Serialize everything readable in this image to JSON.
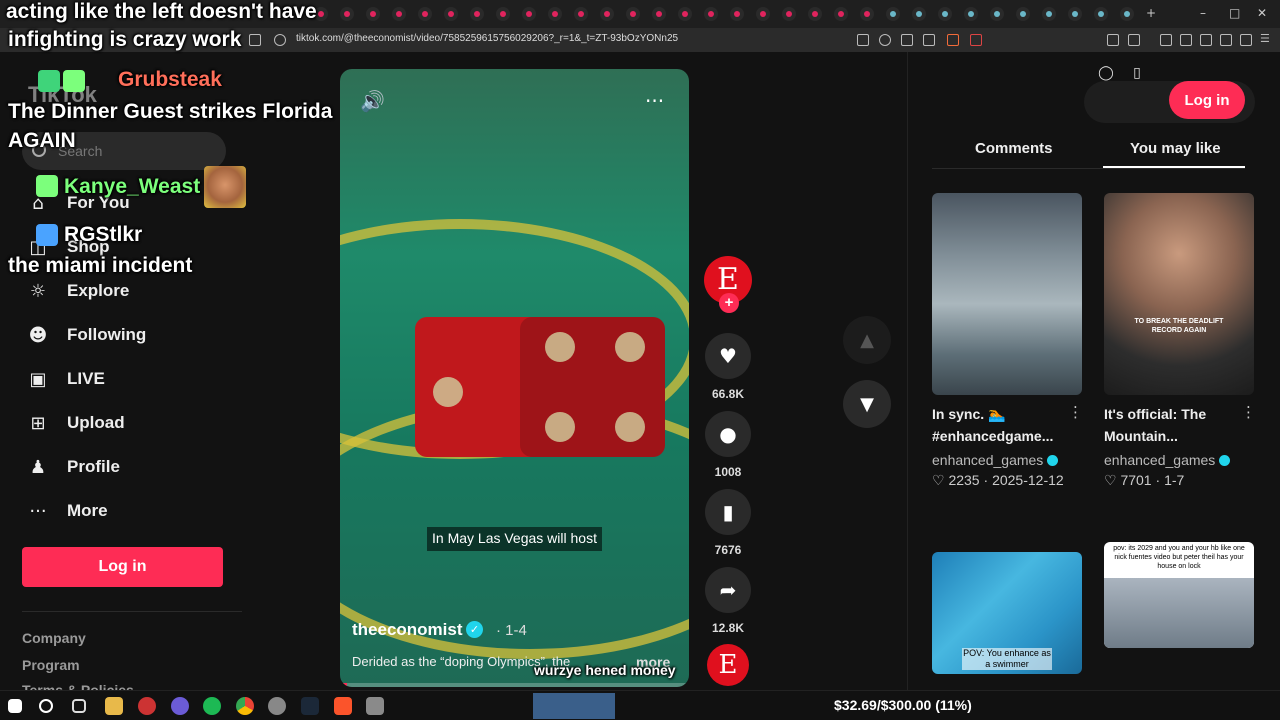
{
  "browser": {
    "url": "tiktok.com/@theeconomist/video/7585259615756029206?_r=1&_t=ZT-93bOzYONn25"
  },
  "sidebar": {
    "logo": "TikTok",
    "search_placeholder": "Search",
    "items": [
      {
        "label": "For You",
        "icon": "home-icon"
      },
      {
        "label": "Shop",
        "icon": "shop-icon"
      },
      {
        "label": "Explore",
        "icon": "compass-icon"
      },
      {
        "label": "Following",
        "icon": "following-icon"
      },
      {
        "label": "LIVE",
        "icon": "live-icon"
      },
      {
        "label": "Upload",
        "icon": "upload-icon"
      },
      {
        "label": "Profile",
        "icon": "profile-icon"
      },
      {
        "label": "More",
        "icon": "more-icon"
      }
    ],
    "login_label": "Log in",
    "footer": [
      "Company",
      "Program",
      "Terms & Policies"
    ]
  },
  "video": {
    "caption": "In May Las Vegas will host",
    "author": "theeconomist",
    "date": "1-4",
    "description": "Derided as the “doping Olympics”, the",
    "more_label": "more",
    "progress": 0.02
  },
  "actions": {
    "avatar_letter": "E",
    "likes": "66.8K",
    "comments": "1008",
    "saves": "7676",
    "shares": "12.8K"
  },
  "right_panel": {
    "login_label": "Log in",
    "tabs": [
      {
        "label": "Comments",
        "active": false
      },
      {
        "label": "You may like",
        "active": true
      }
    ],
    "cards": [
      {
        "title": "In sync. 🏊 #enhancedgame...",
        "user": "enhanced_games",
        "likes": "2235",
        "date": "2025-12-12"
      },
      {
        "title": "It's official: The Mountain...",
        "user": "enhanced_games",
        "likes": "7701",
        "date": "1-7",
        "thumb_text": "TO BREAK THE DEADLIFT RECORD AGAIN"
      },
      {
        "thumb_text": "POV: You enhance as a swimmer"
      },
      {
        "thumb_text": "pov: its 2029 and you and your hb like one nick fuentes video but peter theil has your house on lock"
      }
    ]
  },
  "overlay": {
    "lines": [
      "acting like the left doesn't have",
      "infighting is crazy work",
      "Grubsteak",
      "The Dinner Guest strikes Florida",
      "AGAIN",
      "Kanye_Weast",
      "RGStlkr",
      "the miami incident",
      "wurzye hened money"
    ]
  },
  "taskbar": {
    "budget": "$32.69/$300.00 (11%)"
  },
  "colors": {
    "accent": "#fe2c55",
    "verified": "#20d5ec",
    "background": "#121212"
  }
}
